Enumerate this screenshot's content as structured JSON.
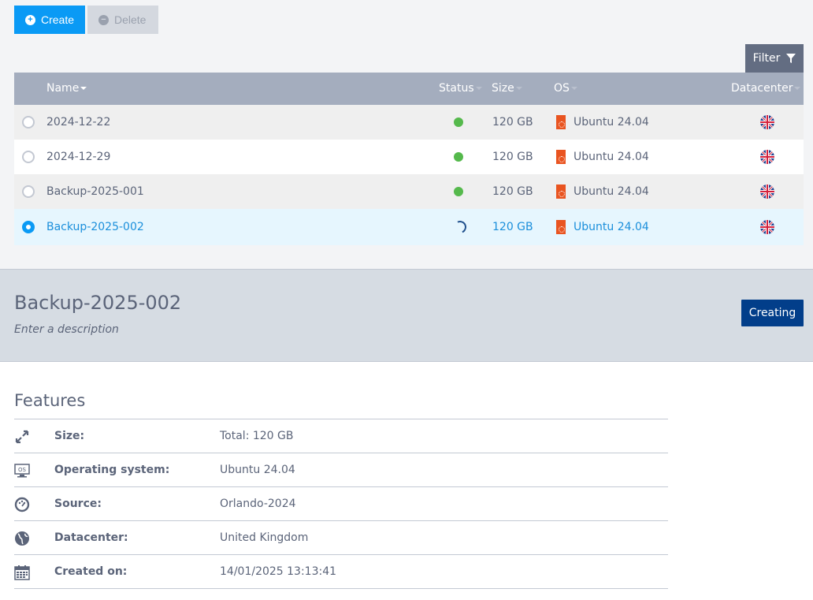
{
  "toolbar": {
    "create_label": "Create",
    "delete_label": "Delete",
    "filter_label": "Filter"
  },
  "table": {
    "columns": {
      "name": "Name",
      "status": "Status",
      "size": "Size",
      "os": "OS",
      "datacenter": "Datacenter"
    },
    "rows": [
      {
        "name": "2024-12-22",
        "status": "active",
        "size": "120 GB",
        "os": "Ubuntu 24.04",
        "datacenter": "United Kingdom",
        "selected": false
      },
      {
        "name": "2024-12-29",
        "status": "active",
        "size": "120 GB",
        "os": "Ubuntu 24.04",
        "datacenter": "United Kingdom",
        "selected": false
      },
      {
        "name": "Backup-2025-001",
        "status": "active",
        "size": "120 GB",
        "os": "Ubuntu 24.04",
        "datacenter": "United Kingdom",
        "selected": false
      },
      {
        "name": "Backup-2025-002",
        "status": "creating",
        "size": "120 GB",
        "os": "Ubuntu 24.04",
        "datacenter": "United Kingdom",
        "selected": true
      }
    ]
  },
  "details": {
    "title": "Backup-2025-002",
    "description_placeholder": "Enter a description",
    "status_button": "Creating"
  },
  "features": {
    "title": "Features",
    "items": [
      {
        "icon": "resize-icon",
        "label": "Size:",
        "value": "Total: 120 GB"
      },
      {
        "icon": "os-monitor-icon",
        "label": "Operating system:",
        "value": "Ubuntu 24.04"
      },
      {
        "icon": "gauge-icon",
        "label": "Source:",
        "value": "Orlando-2024"
      },
      {
        "icon": "globe-icon",
        "label": "Datacenter:",
        "value": "United Kingdom"
      },
      {
        "icon": "calendar-icon",
        "label": "Created on:",
        "value": "14/01/2025 13:13:41"
      }
    ]
  },
  "colors": {
    "primary": "#0a9af5",
    "status_active": "#55b94c",
    "creating_button": "#023e8a",
    "ubuntu": "#e95420"
  }
}
